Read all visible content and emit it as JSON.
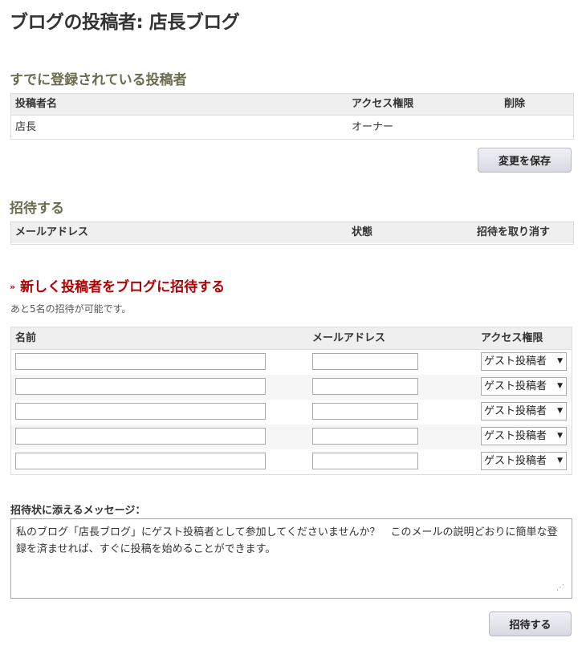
{
  "page": {
    "title": "ブログの投稿者: 店長ブログ"
  },
  "members": {
    "title": "すでに登録されている投稿者",
    "columns": [
      "投稿者名",
      "アクセス権限",
      "削除"
    ],
    "rows": [
      {
        "name": "店長",
        "access": "オーナー",
        "delete": ""
      }
    ],
    "save_label": "変更を保存"
  },
  "pending": {
    "title": "招待する",
    "columns": [
      "メールアドレス",
      "状態",
      "招待を取り消す"
    ]
  },
  "invite": {
    "title": "新しく投稿者をブログに招待する",
    "chevron": "»",
    "remaining": "あと5名の招待が可能です。",
    "columns": [
      "名前",
      "メールアドレス",
      "アクセス権限"
    ],
    "rows": [
      {
        "name": "",
        "email": "",
        "access": "ゲスト投稿者"
      },
      {
        "name": "",
        "email": "",
        "access": "ゲスト投稿者"
      },
      {
        "name": "",
        "email": "",
        "access": "ゲスト投稿者"
      },
      {
        "name": "",
        "email": "",
        "access": "ゲスト投稿者"
      },
      {
        "name": "",
        "email": "",
        "access": "ゲスト投稿者"
      }
    ],
    "message_label": "招待状に添えるメッセージ：",
    "message": "私のブログ「店長ブログ」にゲスト投稿者として参加してくださいませんか？　このメールの説明どおりに簡単な登録を済ませれば、すぐに投稿を始めることができます。",
    "submit_label": "招待する"
  },
  "icons": {
    "dropdown": "chevron-down-icon",
    "resize": "resize-grip-icon"
  }
}
